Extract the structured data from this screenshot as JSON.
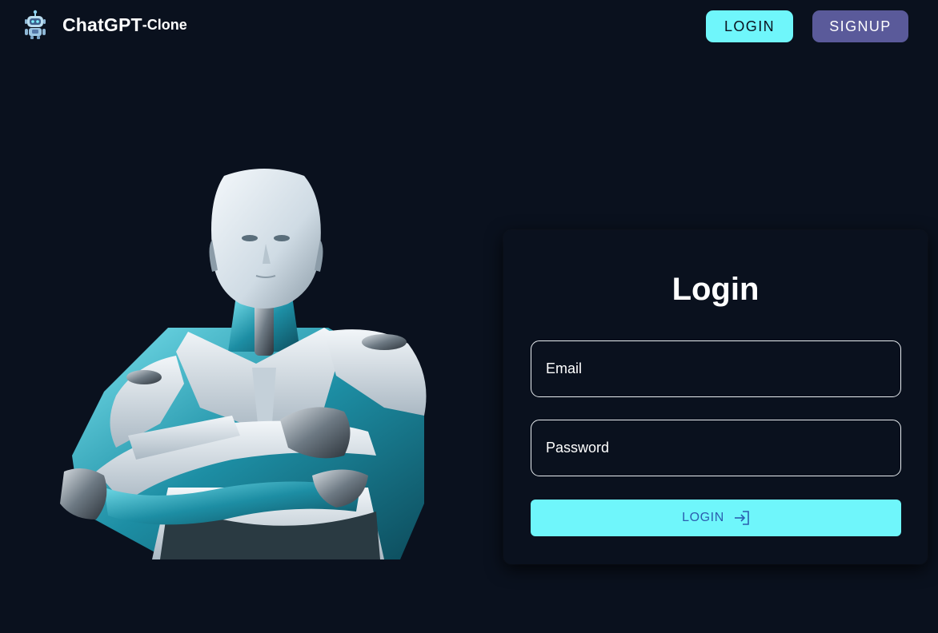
{
  "header": {
    "brand_title": "ChatGPT",
    "brand_suffix": "-Clone",
    "logo_icon": "robot-icon",
    "login_label": "LOGIN",
    "signup_label": "SIGNUP"
  },
  "hero": {
    "image": "robot-illustration"
  },
  "login_form": {
    "title": "Login",
    "email_placeholder": "Email",
    "password_placeholder": "Password",
    "submit_label": "LOGIN",
    "submit_icon": "login-icon"
  },
  "colors": {
    "background": "#0a111e",
    "accent": "#6ff6fb",
    "secondary": "#5a5a9a",
    "button_text": "#2c5fb0"
  }
}
